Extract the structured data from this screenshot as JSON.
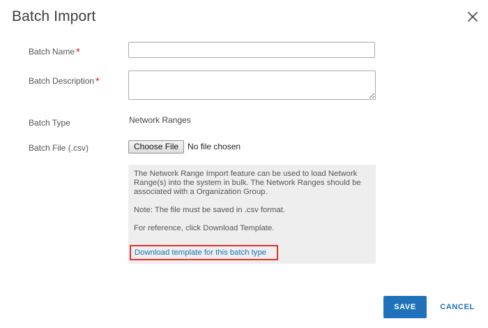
{
  "dialog": {
    "title": "Batch Import",
    "close_icon": "close-icon"
  },
  "form": {
    "batch_name": {
      "label": "Batch Name",
      "required_mark": "*",
      "value": ""
    },
    "batch_description": {
      "label": "Batch Description",
      "required_mark": "*",
      "value": ""
    },
    "batch_type": {
      "label": "Batch Type",
      "value": "Network Ranges"
    },
    "batch_file": {
      "label": "Batch File (.csv)",
      "button_label": "Choose File",
      "status": "No file chosen"
    }
  },
  "info": {
    "paragraph1": "The Network Range Import feature can be used to load Network Range(s) into the system in bulk. The Network Ranges should be associated with a Organization Group.",
    "paragraph2": "Note: The file must be saved in .csv format.",
    "paragraph3": "For reference, click Download Template.",
    "download_link": "Download template for this batch type"
  },
  "footer": {
    "save_label": "SAVE",
    "cancel_label": "CANCEL"
  },
  "colors": {
    "primary": "#1f72b9",
    "required": "#d9261c",
    "highlight_border": "#e0312d",
    "info_bg": "#eeeeee"
  }
}
